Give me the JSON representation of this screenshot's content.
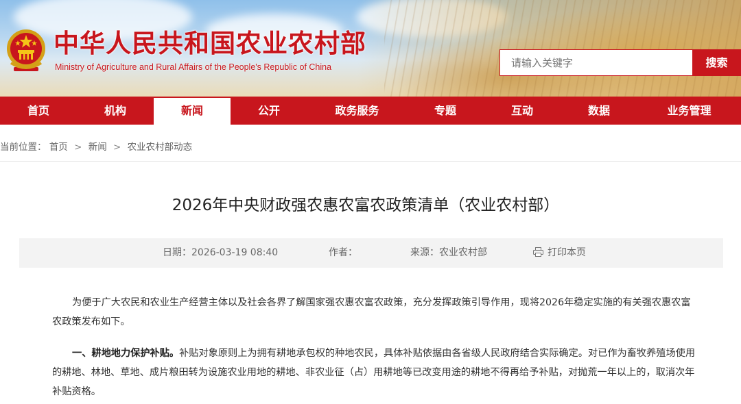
{
  "header": {
    "site_title": "中华人民共和国农业农村部",
    "site_subtitle": "Ministry of Agriculture and Rural Affairs of the People's Republic of China",
    "search_placeholder": "请输入关键字",
    "search_button": "搜索",
    "emblem_icon": "national-emblem-icon"
  },
  "nav": {
    "items": [
      {
        "label": "首页"
      },
      {
        "label": "机构"
      },
      {
        "label": "新闻"
      },
      {
        "label": "公开"
      },
      {
        "label": "政务服务"
      },
      {
        "label": "专题"
      },
      {
        "label": "互动"
      },
      {
        "label": "数据"
      },
      {
        "label": "业务管理"
      }
    ],
    "active": "新闻"
  },
  "breadcrumb": {
    "prefix": "当前位置：",
    "items": [
      "首页",
      "新闻",
      "农业农村部动态"
    ],
    "separator": ">"
  },
  "article": {
    "title": "2026年中央财政强农惠农富农政策清单（农业农村部）",
    "meta": {
      "date_label": "日期：",
      "date": "2026-03-19 08:40",
      "author_label": "作者：",
      "author": "",
      "source_label": "来源：",
      "source": "农业农村部",
      "print_label": "打印本页",
      "print_icon": "printer-icon"
    },
    "paragraphs": {
      "intro": "为便于广大农民和农业生产经营主体以及社会各界了解国家强农惠农富农政策，充分发挥政策引导作用，现将2026年稳定实施的有关强农惠农富农政策发布如下。",
      "section1_heading": "一、耕地地力保护补贴。",
      "section1_body": "补贴对象原则上为拥有耕地承包权的种地农民，具体补贴依据由各省级人民政府结合实际确定。对已作为畜牧养殖场使用的耕地、林地、草地、成片粮田转为设施农业用地的耕地、非农业征（占）用耕地等已改变用途的耕地不得再给予补贴，对抛荒一年以上的，取消次年补贴资格。"
    }
  },
  "colors": {
    "brand_red": "#c8161d",
    "meta_bg": "#f3f3f3"
  }
}
